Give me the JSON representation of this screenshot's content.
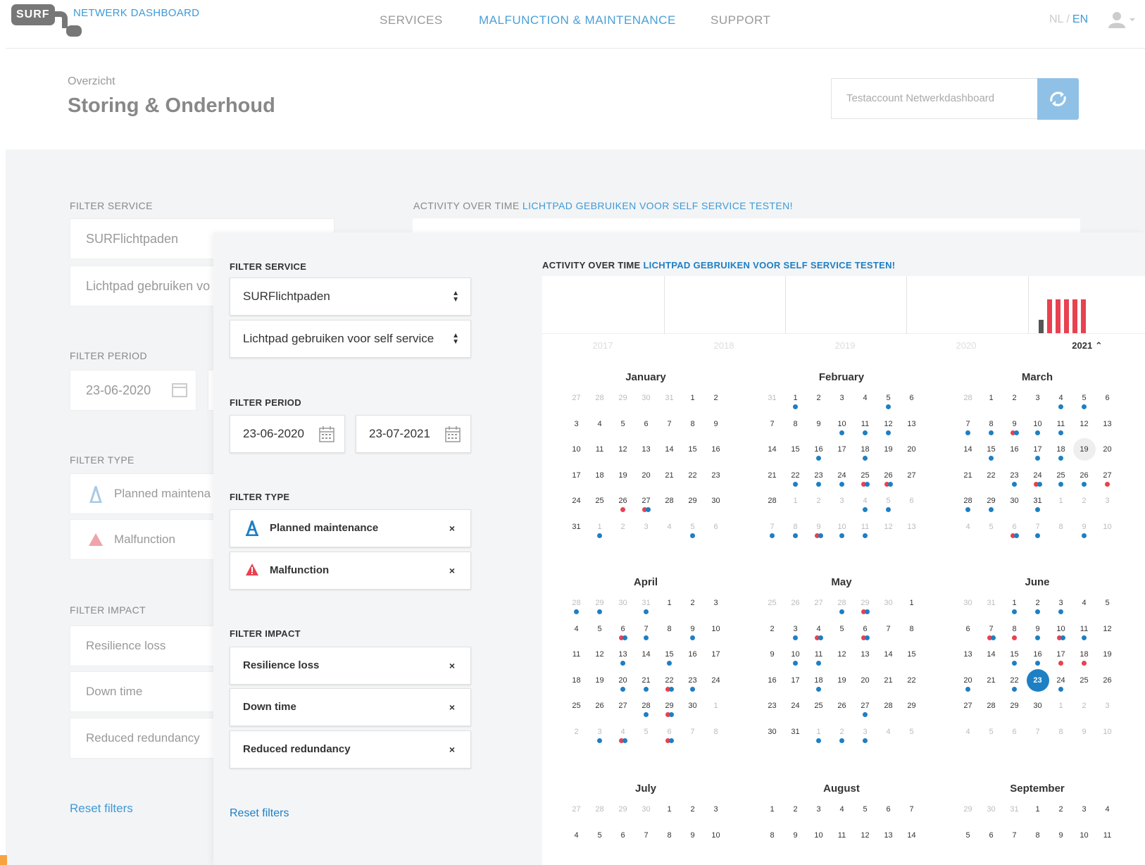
{
  "header": {
    "logo": "SURF",
    "app_name": "NETWERK DASHBOARD",
    "nav": [
      "SERVICES",
      "MALFUNCTION & MAINTENANCE",
      "SUPPORT"
    ],
    "lang_nl": "NL",
    "lang_sep": "/",
    "lang_en": "EN"
  },
  "page": {
    "breadcrumb": "Overzicht",
    "title": "Storing & Onderhoud",
    "account": "Testaccount Netwerkdashboard"
  },
  "bg": {
    "filter_service": "FILTER SERVICE",
    "service": "SURFlichtpaden",
    "subservice": "Lichtpad gebruiken vo",
    "filter_period": "FILTER PERIOD",
    "date_from": "23-06-2020",
    "filter_type": "FILTER TYPE",
    "type1": "Planned maintena",
    "type2": "Malfunction",
    "filter_impact": "FILTER IMPACT",
    "impact1": "Resilience loss",
    "impact2": "Down time",
    "impact3": "Reduced redundancy",
    "reset": "Reset filters",
    "activity": "ACTIVITY OVER TIME",
    "activity_link": "LICHTPAD GEBRUIKEN VOOR SELF SERVICE TESTEN!"
  },
  "filters": {
    "service_label": "FILTER SERVICE",
    "service": "SURFlichtpaden",
    "subservice": "Lichtpad gebruiken voor self service",
    "period_label": "FILTER PERIOD",
    "date_from": "23-06-2020",
    "date_to": "23-07-2021",
    "type_label": "FILTER TYPE",
    "types": [
      "Planned maintenance",
      "Malfunction"
    ],
    "impact_label": "FILTER IMPACT",
    "impacts": [
      "Resilience loss",
      "Down time",
      "Reduced redundancy"
    ],
    "remove": "×",
    "reset": "Reset filters"
  },
  "activity": {
    "title": "ACTIVITY OVER TIME",
    "link": "LICHTPAD GEBRUIKEN VOOR SELF SERVICE TESTEN!",
    "years": [
      "2017",
      "2018",
      "2019",
      "2020",
      "2021"
    ],
    "active_year": "2021",
    "bars_2021": [
      {
        "color": "#555555",
        "value": 0.4
      },
      {
        "color": "#e8414f",
        "value": 1
      },
      {
        "color": "#e8414f",
        "value": 1
      },
      {
        "color": "#e8414f",
        "value": 1
      },
      {
        "color": "#e8414f",
        "value": 1
      },
      {
        "color": "#e8414f",
        "value": 1
      }
    ]
  },
  "colors": {
    "maintenance": "#1d7fc4",
    "malfunction": "#e8414f",
    "link": "#1d7fc4"
  },
  "calendar": [
    {
      "name": "January",
      "weeks": [
        [
          "27m",
          "28m",
          "29m",
          "30m",
          "31m",
          "1",
          "2"
        ],
        [
          "3",
          "4",
          "5",
          "6",
          "7",
          "8",
          "9"
        ],
        [
          "10",
          "11",
          "12",
          "13",
          "14",
          "15",
          "16"
        ],
        [
          "17",
          "18",
          "19",
          "20",
          "21",
          "22",
          "23"
        ],
        [
          "24",
          "25",
          "26:r",
          "27:rb",
          "28",
          "29",
          "30"
        ],
        [
          "31",
          "1m:b",
          "2m",
          "3m",
          "4m",
          "5m:b",
          "6m"
        ]
      ]
    },
    {
      "name": "February",
      "weeks": [
        [
          "31m",
          "1:b",
          "2",
          "3",
          "4",
          "5:b",
          "6"
        ],
        [
          "7",
          "8",
          "9",
          "10:b",
          "11:b",
          "12:b",
          "13"
        ],
        [
          "14",
          "15",
          "16:b",
          "17",
          "18:b",
          "19",
          "20"
        ],
        [
          "21",
          "22:b",
          "23:b",
          "24:b",
          "25:rb",
          "26:rb",
          "27"
        ],
        [
          "28",
          "1m",
          "2m",
          "3m",
          "4m:b",
          "5m:b",
          "6m"
        ],
        [
          "7m:b",
          "8m:b",
          "9m:rb",
          "10m:b",
          "11m:b",
          "12m",
          "13m"
        ]
      ]
    },
    {
      "name": "March",
      "weeks": [
        [
          "28m",
          "1",
          "2",
          "3",
          "4:b",
          "5:b",
          "6"
        ],
        [
          "7:b",
          "8:b",
          "9:rb",
          "10:b",
          "11:b",
          "12",
          "13"
        ],
        [
          "14",
          "15:b",
          "16",
          "17:b",
          "18:b",
          "19h",
          "20"
        ],
        [
          "21",
          "22",
          "23:b",
          "24:rb",
          "25:b",
          "26:b",
          "27:r"
        ],
        [
          "28:b",
          "29:b",
          "30",
          "31:b",
          "1m",
          "2m",
          "3m"
        ],
        [
          "4m",
          "5m",
          "6m:rb",
          "7m:b",
          "8m",
          "9m:b",
          "10m"
        ]
      ]
    },
    {
      "name": "April",
      "weeks": [
        [
          "28m:b",
          "29m:b",
          "30m",
          "31m:b",
          "1",
          "2",
          "3"
        ],
        [
          "4",
          "5",
          "6:rb",
          "7:b",
          "8",
          "9:b",
          "10"
        ],
        [
          "11",
          "12",
          "13:b",
          "14",
          "15:b",
          "16",
          "17"
        ],
        [
          "18",
          "19",
          "20:b",
          "21:b",
          "22:rb",
          "23:b",
          "24"
        ],
        [
          "25",
          "26",
          "27",
          "28:b",
          "29:rb",
          "30",
          "1m"
        ],
        [
          "2m",
          "3m:b",
          "4m:rb",
          "5m",
          "6m:rb",
          "7m",
          "8m"
        ]
      ]
    },
    {
      "name": "May",
      "weeks": [
        [
          "25m",
          "26m",
          "27m",
          "28m:b",
          "29m:rb",
          "30m",
          "1"
        ],
        [
          "2",
          "3:b",
          "4:rb",
          "5",
          "6:rb",
          "7",
          "8"
        ],
        [
          "9",
          "10:b",
          "11:b",
          "12",
          "13",
          "14",
          "15"
        ],
        [
          "16",
          "17",
          "18:b",
          "19",
          "20",
          "21",
          "22"
        ],
        [
          "23",
          "24",
          "25",
          "26",
          "27:b",
          "28",
          "29"
        ],
        [
          "30",
          "31",
          "1m:b",
          "2m:b",
          "3m:b",
          "4m",
          "5m"
        ]
      ]
    },
    {
      "name": "June",
      "weeks": [
        [
          "30m",
          "31m",
          "1:b",
          "2:b",
          "3:b",
          "4",
          "5"
        ],
        [
          "6",
          "7:rb",
          "8:r",
          "9:b",
          "10:rb",
          "11:b",
          "12"
        ],
        [
          "13",
          "14",
          "15:b",
          "16:b",
          "17:r",
          "18:r",
          "19"
        ],
        [
          "20:b",
          "21",
          "22:b",
          "23t",
          "24:b",
          "25",
          "26"
        ],
        [
          "27",
          "28",
          "29",
          "30",
          "1m",
          "2m",
          "3m"
        ],
        [
          "4m",
          "5m",
          "6m",
          "7m",
          "8m",
          "9m",
          "10m"
        ]
      ]
    },
    {
      "name": "July",
      "weeks": [
        [
          "27m",
          "28m",
          "29m",
          "30m",
          "1",
          "2",
          "3"
        ],
        [
          "4",
          "5",
          "6",
          "7",
          "8",
          "9",
          "10"
        ]
      ]
    },
    {
      "name": "August",
      "weeks": [
        [
          "1",
          "2",
          "3",
          "4",
          "5",
          "6",
          "7"
        ],
        [
          "8",
          "9",
          "10",
          "11",
          "12",
          "13",
          "14"
        ]
      ]
    },
    {
      "name": "September",
      "weeks": [
        [
          "29m",
          "30m",
          "31m",
          "1",
          "2",
          "3",
          "4"
        ],
        [
          "5",
          "6",
          "7",
          "8",
          "9",
          "10",
          "11"
        ]
      ]
    }
  ]
}
